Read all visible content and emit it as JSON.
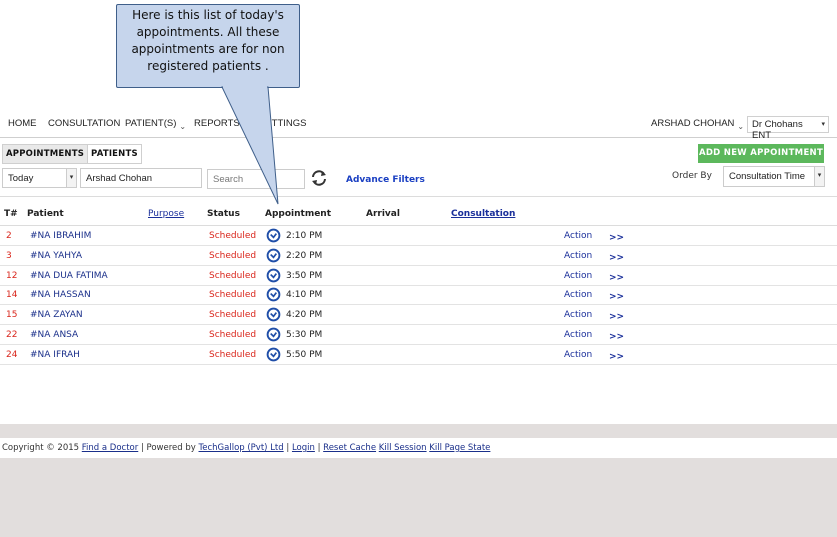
{
  "callout": {
    "text": "Here is this list of today's appointments. All these appointments are for non registered patients ."
  },
  "nav": {
    "items": [
      "HOME",
      "CONSULTATION",
      "PATIENT(S)",
      "REPORTS",
      "SETTINGS"
    ],
    "user": "ARSHAD CHOHAN",
    "clinic": "Dr Chohans ENT"
  },
  "tabs": {
    "appointments": "APPOINTMENTS",
    "patients": "PATIENTS"
  },
  "add_button": "ADD NEW APPOINTMENT",
  "filters": {
    "date": "Today",
    "doctor": "Arshad Chohan",
    "search_placeholder": "Search",
    "advance": "Advance Filters",
    "order_by_label": "Order By",
    "order_by_value": "Consultation Time"
  },
  "table": {
    "headers": {
      "t": "T#",
      "patient": "Patient",
      "purpose": "Purpose",
      "status": "Status",
      "appointment": "Appointment",
      "arrival": "Arrival",
      "consultation": "Consultation"
    },
    "rows": [
      {
        "t": "2",
        "patient": "#NA IBRAHIM",
        "status": "Scheduled",
        "time": "2:10 PM",
        "action": "Action",
        "go": ">>"
      },
      {
        "t": "3",
        "patient": "#NA YAHYA",
        "status": "Scheduled",
        "time": "2:20 PM",
        "action": "Action",
        "go": ">>"
      },
      {
        "t": "12",
        "patient": "#NA DUA FATIMA",
        "status": "Scheduled",
        "time": "3:50 PM",
        "action": "Action",
        "go": ">>"
      },
      {
        "t": "14",
        "patient": "#NA HASSAN",
        "status": "Scheduled",
        "time": "4:10 PM",
        "action": "Action",
        "go": ">>"
      },
      {
        "t": "15",
        "patient": "#NA ZAYAN",
        "status": "Scheduled",
        "time": "4:20 PM",
        "action": "Action",
        "go": ">>"
      },
      {
        "t": "22",
        "patient": "#NA ANSA",
        "status": "Scheduled",
        "time": "5:30 PM",
        "action": "Action",
        "go": ">>"
      },
      {
        "t": "24",
        "patient": "#NA IFRAH",
        "status": "Scheduled",
        "time": "5:50 PM",
        "action": "Action",
        "go": ">>"
      }
    ]
  },
  "footer": {
    "copyright": "Copyright © 2015",
    "find_doctor": "Find a Doctor",
    "powered": "| Powered by",
    "techgallop": "TechGallop (Pvt) Ltd",
    "sep": "|",
    "login": "Login",
    "reset_cache": "Reset Cache",
    "kill_session": "Kill Session",
    "kill_page_state": "Kill Page State"
  },
  "colors": {
    "accent_green": "#5cb85c",
    "status_red": "#d9261c",
    "link_blue": "#1a2f9a",
    "callout_fill": "#c6d5ec"
  },
  "icons": {
    "clock": "clock-icon",
    "refresh": "refresh-icon"
  }
}
